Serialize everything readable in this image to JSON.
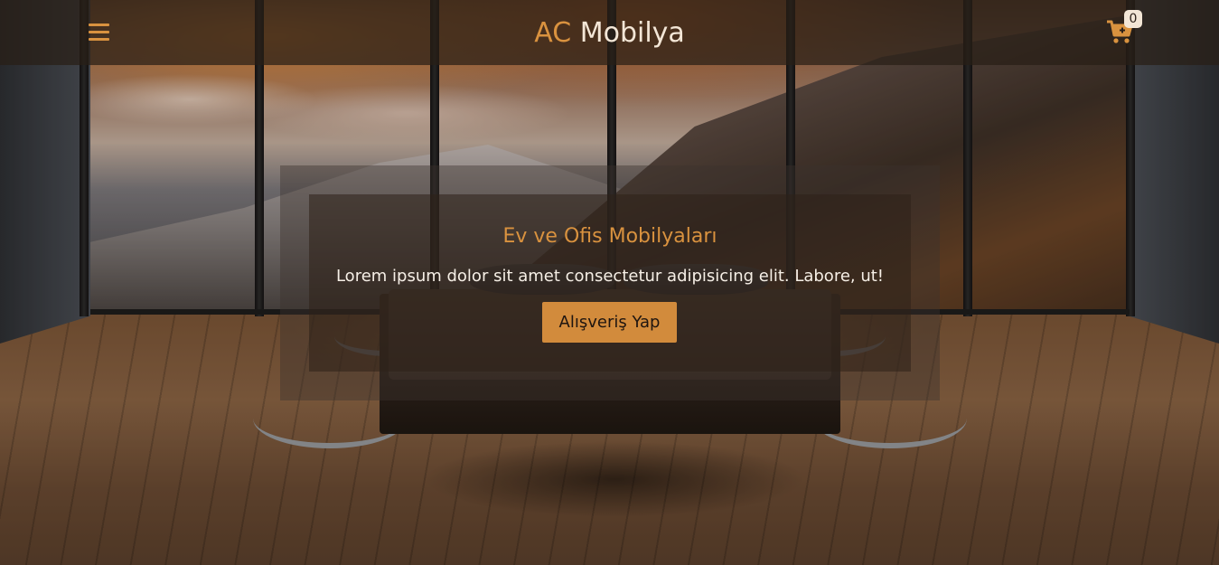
{
  "navbar": {
    "brand_prefix": "AC",
    "brand_name": "Mobilya",
    "menu_icon": "hamburger-menu-icon",
    "cart_icon": "shopping-cart-plus-icon",
    "cart_count": "0"
  },
  "hero": {
    "title": "Ev ve Ofis Mobilyaları",
    "text": "Lorem ipsum dolor sit amet consectetur adipisicing elit. Labore, ut!",
    "button_label": "Alışveriş Yap"
  },
  "colors": {
    "accent": "#d9923f",
    "brand_light": "#f3e6d6",
    "button_bg": "#d28b3c"
  }
}
